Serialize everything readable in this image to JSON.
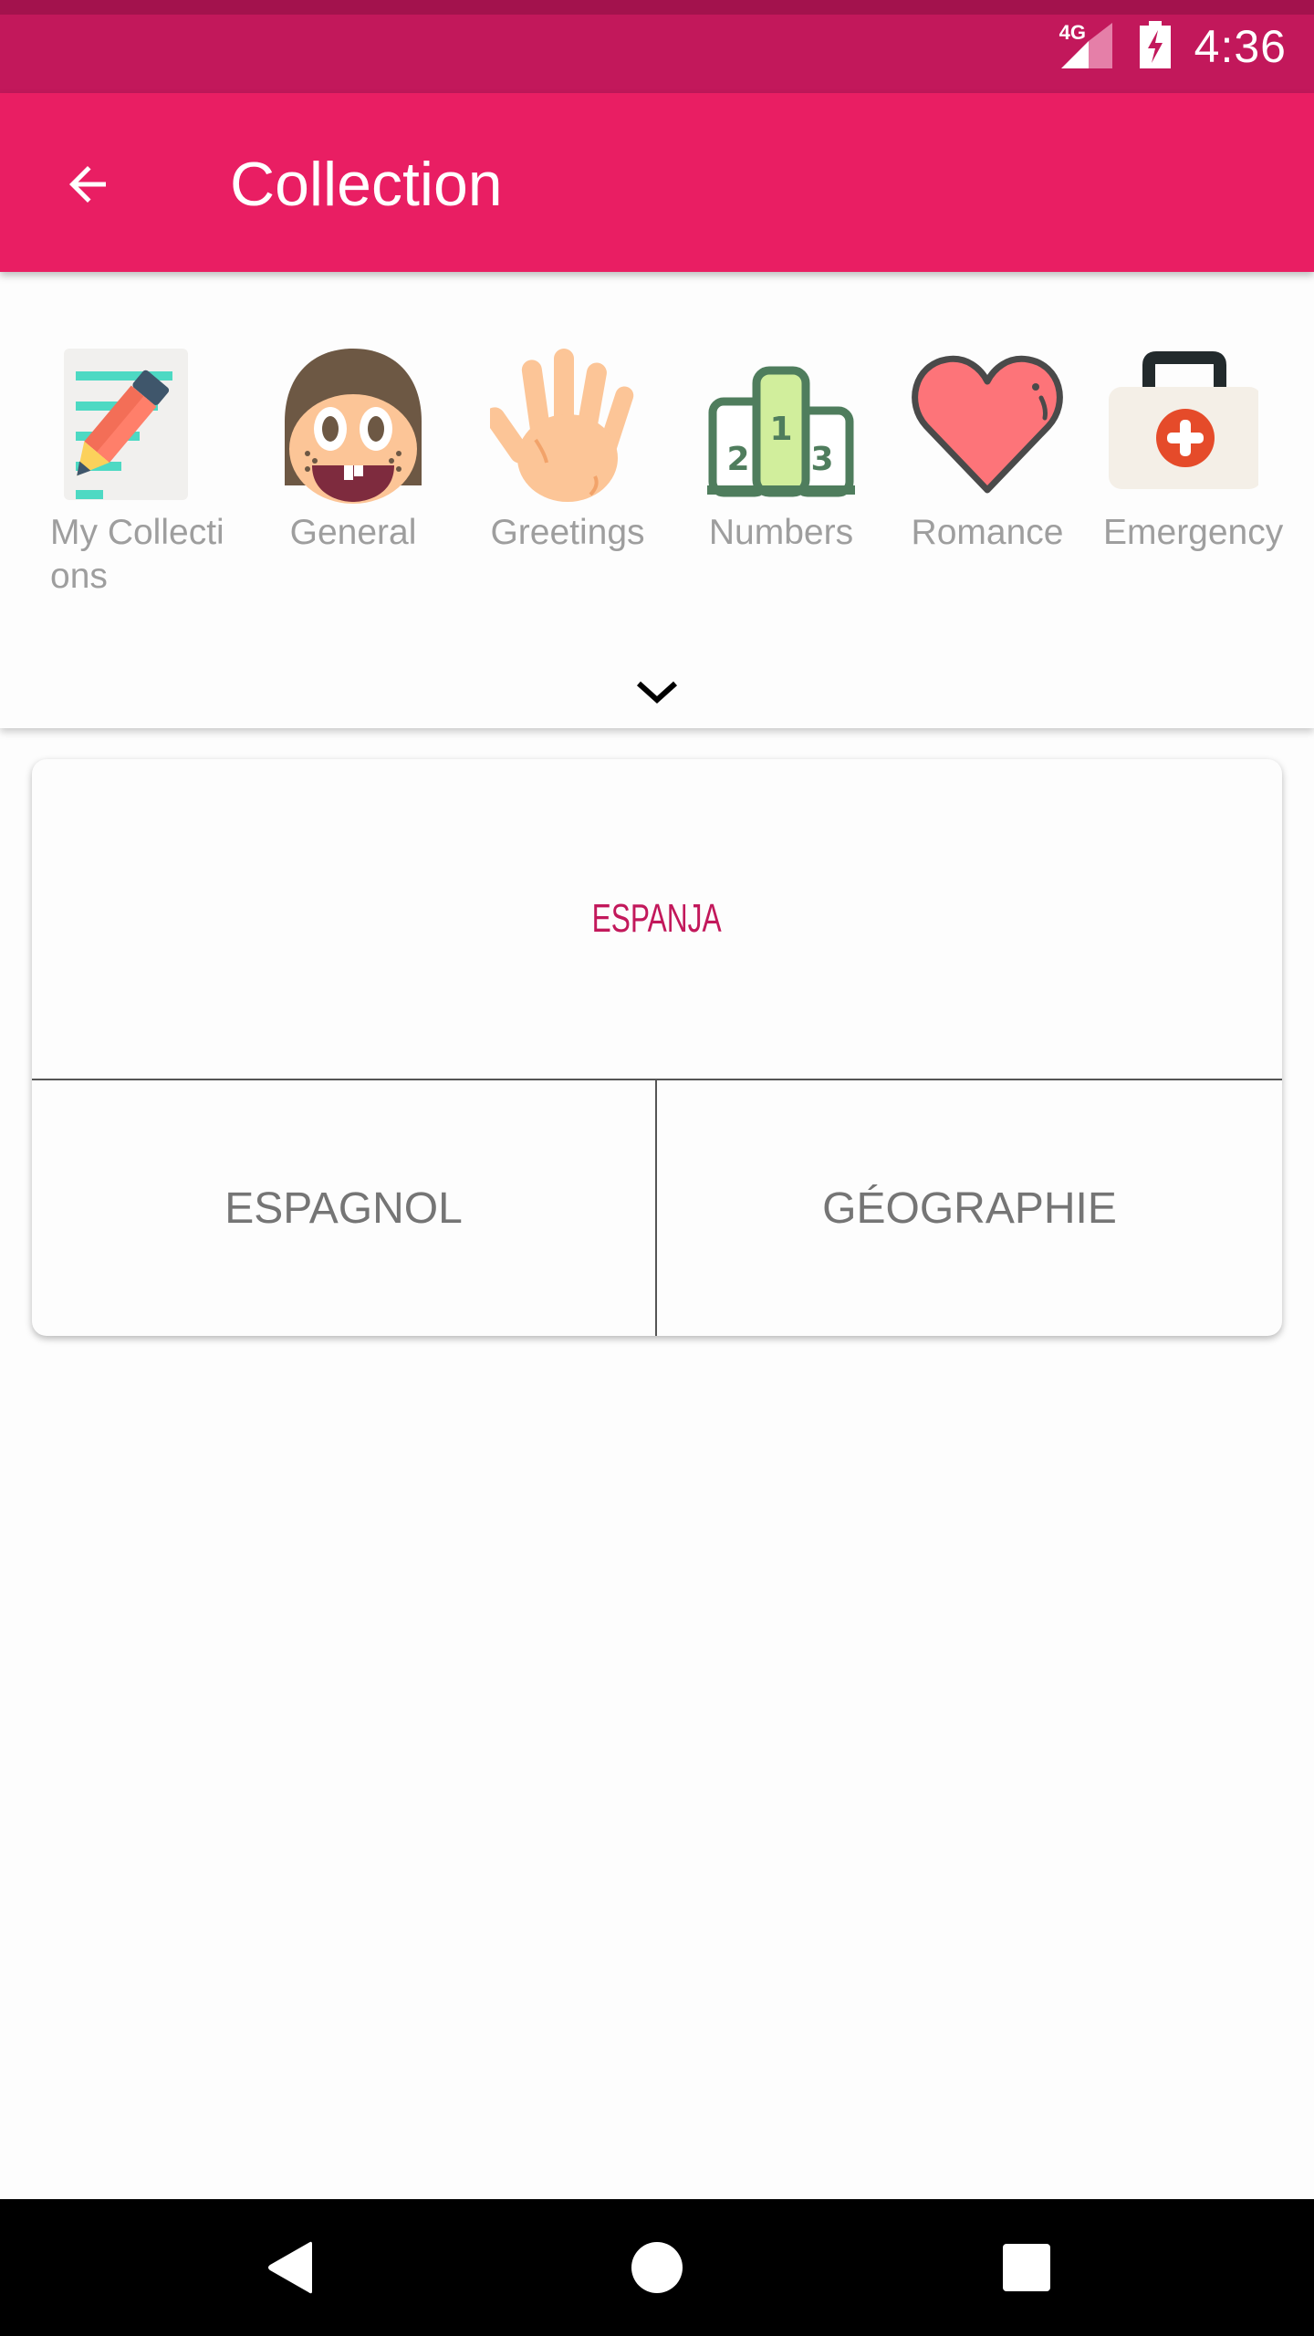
{
  "status_bar": {
    "network": "4G",
    "time": "4:36",
    "icons": [
      "signal-icon",
      "battery-charging-icon"
    ]
  },
  "app_bar": {
    "title": "Collection",
    "back_icon": "arrow-back-icon"
  },
  "categories": [
    {
      "label": "My Collections",
      "icon": "notes-pencil-icon"
    },
    {
      "label": "General",
      "icon": "smiling-face-icon"
    },
    {
      "label": "Greetings",
      "icon": "waving-hand-icon"
    },
    {
      "label": "Numbers",
      "icon": "podium-icon"
    },
    {
      "label": "Romance",
      "icon": "heart-icon"
    },
    {
      "label": "Emergency",
      "icon": "first-aid-kit-icon"
    }
  ],
  "expand_icon": "chevron-down-icon",
  "quiz": {
    "question": "ESPANJA",
    "answers": [
      "ESPAGNOL",
      "GÉOGRAPHIE"
    ]
  },
  "colors": {
    "status_bar": "#c2185b",
    "app_bar": "#e91e63",
    "question_text": "#c2185b",
    "answer_text": "#757575",
    "category_label": "#9e9e9e"
  },
  "nav_bar": {
    "buttons": [
      "back",
      "home",
      "recents"
    ]
  }
}
